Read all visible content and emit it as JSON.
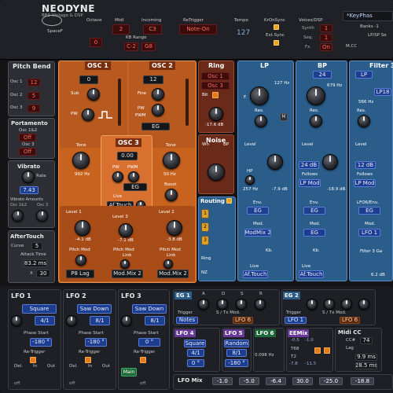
{
  "header": {
    "brand": "NEODYNE",
    "subtitle": "BB3 Vintage & DSP",
    "brand_small": "SpaceF",
    "octave_label": "Octave",
    "octave_value": "0",
    "midi_label": "Midi",
    "midi_value": "2",
    "incoming_label": "Incoming",
    "incoming_value": "C3",
    "kb_range_label": "KB Range",
    "kb_range_low": "C-2",
    "kb_range_high": "G8",
    "retrigger_label": "ReTrigger",
    "retrigger_value": "Note-On",
    "tempo_label": "Tempo",
    "tempo_value": "127",
    "kronsync_label": "KrOnSync",
    "extsync_label": "Ext.Sync",
    "voices_label": "Voices/DSP",
    "synth_label": "Synth",
    "synth_value": "1",
    "seq_label": "Seq.",
    "seq_value": "1",
    "fx_label": "Fx.",
    "fx_value": "On",
    "preset_name": "*KeyPhas",
    "banks_label": "Banks -1",
    "lpsp_label": "LP/SP Se",
    "mcc_label": "M.CC"
  },
  "left": {
    "pitchbend": {
      "title": "Pitch Bend",
      "rows": [
        {
          "label": "Osc 1",
          "value": "12"
        },
        {
          "label": "Osc 2",
          "value": "5"
        },
        {
          "label": "Osc 3",
          "value": "9"
        }
      ]
    },
    "portamento": {
      "title": "Portamento",
      "row1_label": "Osc 1&2",
      "row1_value": "Off",
      "row2_label": "Osc 3",
      "row2_value": "Off"
    },
    "vibrato": {
      "title": "Vibrato",
      "rate_label": "Rate",
      "rate_value": "7.43",
      "amounts_label": "Vibrato Amounts",
      "osc_labels": [
        "Osc 1&2",
        "Osc 3"
      ]
    },
    "aftertouch": {
      "title": "AfterTouch",
      "curve_label": "Curve",
      "curve_value": "5",
      "attack_label": "Attack Time",
      "attack_value": "83.2 ms",
      "x_label": "X",
      "x_value": "30"
    }
  },
  "osc1": {
    "title": "OSC 1",
    "value": "0",
    "sub_label": "Sub",
    "pw_label": "PW",
    "tone_label": "Tone",
    "tone_value": "992 Hz",
    "level_label": "Level 1",
    "level_value": "-4.1 dB",
    "pitchmod_label": "Pitch Mod",
    "pitchmod_value": "P8 Lag"
  },
  "osc2": {
    "title": "OSC 2",
    "value": "12",
    "fine_label": "Fine",
    "pwm_label": "PWM",
    "eg_value": "EG",
    "tone_label": "Tone",
    "tone_value": "50 Hz",
    "boost_label": "Boost",
    "level_label": "Level 2",
    "level_value": "-3.8 dB",
    "pitchmod_label": "Pitch Mod",
    "link_label": "Link",
    "pitchmod_value": "Mod.Mix 2"
  },
  "osc3": {
    "title": "OSC 3",
    "value": "0.00",
    "pw_label": "PW",
    "pwm_label": "PWM",
    "eg_value": "EG",
    "live_label": "Live",
    "live_value": "Af.Touch",
    "level_label": "Level 3",
    "level_value": "-7.1 dB",
    "pitchmod_label": "Pitch Mod",
    "link_label": "Link",
    "pitchmod_value": "Mod.Mix 2"
  },
  "ring": {
    "title": "Ring",
    "osc1": "Osc 1",
    "osc3": "Osc 3",
    "bit_label": "Bit",
    "level_value": "-17.6 dB"
  },
  "noise": {
    "title": "Noise",
    "wh": "Wh",
    "bp": "BP"
  },
  "routing": {
    "title": "Routing",
    "items": [
      "1",
      "2",
      "3"
    ],
    "ring_label": "Ring",
    "nz_label": "NZ"
  },
  "lp": {
    "title": "LP",
    "f_label": "F.",
    "freq_value": "127 Hz",
    "res_label": "Res.",
    "m_label": "M",
    "level_label": "Level",
    "hp_label": "HP",
    "hp_value": "257 Hz",
    "level_value": "-7.9 dB",
    "env_label": "Env.",
    "env_value": "EG",
    "mod_label": "Mod.",
    "mod_value": "ModMix 2",
    "kb_label": "Kb.",
    "live_label": "Live",
    "live_value": "Af.Touch"
  },
  "bp": {
    "title": "BP",
    "value": "24",
    "freq_value": "679 Hz",
    "res_label": "Res.",
    "level_label": "Level",
    "hp_value": "24 dB",
    "follows_label": "Follows",
    "follows_value": "LP Mod",
    "level_value": "-18.9 dB",
    "env_label": "Env.",
    "env_value": "EG",
    "mod_label": "Mod.",
    "mod_value": "EG",
    "kb_label": "Kb.",
    "live_label": "Live",
    "live_value": "Af.Touch"
  },
  "filter3": {
    "title": "Filter 3",
    "type_value": "LP",
    "mode_value": "LP18",
    "freq_value": "566 Hz",
    "res_label": "Res.",
    "level_label": "Level",
    "hp_value": "12 dB",
    "follows_label": "Follows",
    "follows_value": "LP Mod",
    "lfo_label": "LFO6/Env.",
    "lfo_value": "EG",
    "mod_label": "Mod.",
    "mod_value": "LFO 1",
    "gain_label": "Filter 3 Ga",
    "gain_value": "6.2 dB"
  },
  "lfo1": {
    "title": "LFO 1",
    "wave": "Square",
    "rate": "4/1",
    "phase_label": "Phase Start",
    "phase_value": "-180 °",
    "retrigger": "Re-Trigger",
    "del": "Del.",
    "in": "In",
    "out": "Out",
    "off": "off"
  },
  "lfo2": {
    "title": "LFO 2",
    "wave": "Saw Down",
    "rate": "8/1",
    "phase_label": "Phase Start",
    "phase_value": "-180 °",
    "retrigger": "Re-Trigger",
    "del": "Del.",
    "in": "In",
    "out": "Out",
    "off": "off"
  },
  "lfo3": {
    "title": "LFO 3",
    "wave": "Saw Down",
    "rate": "8/1",
    "phase_label": "Phase Start",
    "phase_value": "0 °",
    "retrigger": "Re-Trigger",
    "main_label": "Main",
    "off": "off"
  },
  "eg1": {
    "title": "EG 1",
    "a": "A",
    "d": "D",
    "s": "S",
    "r": "R",
    "trigger_label": "Trigger",
    "trigger_value": "Notes",
    "s_tx_label": "S / Tx Mod.",
    "tx": "TX",
    "mod_value": "LFO 6"
  },
  "eg2": {
    "title": "EG 2",
    "trigger_label": "Trigger",
    "trigger_value": "LFO 1",
    "s_tx_label": "S / Tx Mod.",
    "mod_value": "LFO 6"
  },
  "lfo4": {
    "title": "LFO 4",
    "wave": "Square",
    "rate": "4/1",
    "phase": "0 °"
  },
  "lfo5": {
    "title": "LFO 5",
    "wave": "Random",
    "rate": "8/1",
    "phase": "-180 °"
  },
  "lfo6": {
    "title": "LFO 6",
    "rate": "0.098 Hz",
    "lfo_mix_label": "LFO Mix"
  },
  "eemix": {
    "title": "EEMix",
    "values": [
      "-0.5",
      "-7.8",
      "-1.0",
      "-11.5"
    ],
    "labels": [
      "T68",
      "T2"
    ]
  },
  "midicc": {
    "title": "Midi CC",
    "cc_label": "CC#",
    "cc_value": "74",
    "lag_label": "Lag",
    "val1": "9.9 ms",
    "val2": "28.5 ms"
  },
  "bottom_mix": {
    "values": [
      "-1.0",
      "-5.0",
      "-6.4",
      "30.0",
      "-25.0",
      "-18.8"
    ]
  },
  "colors": {
    "orange": "#c8621f",
    "blue": "#2a5d8a",
    "accent": "#e08a1c"
  }
}
